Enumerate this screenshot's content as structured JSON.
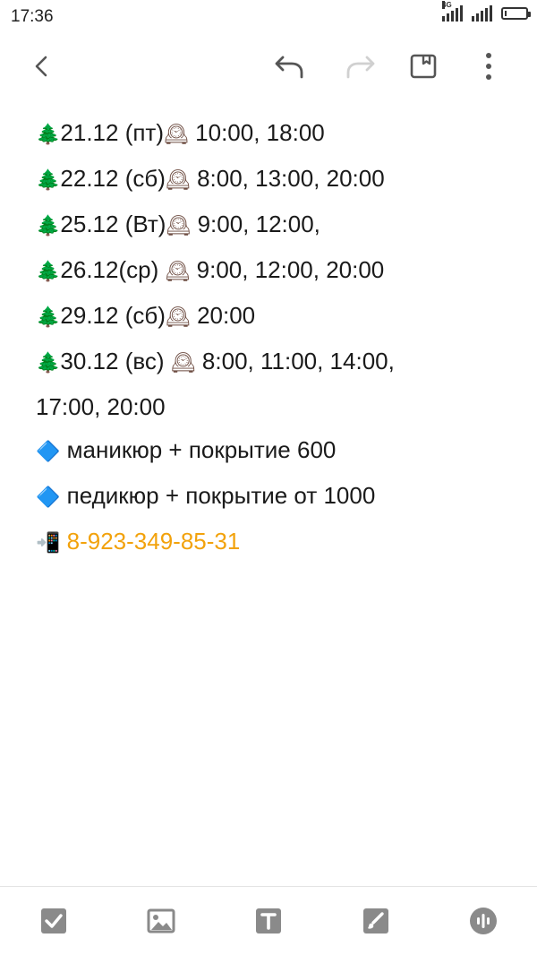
{
  "status_bar": {
    "time": "17:36",
    "network_label": "4G",
    "battery_level": 0.08
  },
  "toolbar": {
    "icons": [
      "back-arrow",
      "undo",
      "redo",
      "bookmark",
      "more-vertical"
    ],
    "redo_enabled": false
  },
  "note": {
    "lines": [
      {
        "emoji": "🌲",
        "text": "21.12 (пт)",
        "clock": "🕰",
        "times": " 10:00, 18:00"
      },
      {
        "emoji": "🌲",
        "text": "22.12 (сб)",
        "clock": "🕰",
        "times": " 8:00, 13:00, 20:00"
      },
      {
        "emoji": "🌲",
        "text": "25.12 (Вт)",
        "clock": "🕰",
        "times": " 9:00, 12:00,"
      },
      {
        "emoji": "🌲",
        "text": "26.12(ср) ",
        "clock": "🕰",
        "times": " 9:00, 12:00, 20:00"
      },
      {
        "emoji": "🌲",
        "text": "29.12 (сб)",
        "clock": "🕰",
        "times": " 20:00"
      },
      {
        "emoji": "🌲",
        "text": "30.12 (вс) ",
        "clock": "🕰",
        "times": " 8:00, 11:00, 14:00,"
      }
    ],
    "continuation": "17:00, 20:00",
    "services": [
      {
        "emoji": "🔷",
        "text": " маникюр + покрытие 600"
      },
      {
        "emoji": "🔷",
        "text": " педикюр + покрытие от 1000"
      }
    ],
    "contact": {
      "emoji": "📲",
      "phone": " 8-923-349-85-31"
    }
  },
  "bottom_bar": {
    "icons": [
      "checkbox",
      "image",
      "text-format",
      "brush",
      "voice"
    ]
  },
  "colors": {
    "accent_phone": "#f2a20c",
    "icon_gray": "#8a8a8a"
  }
}
